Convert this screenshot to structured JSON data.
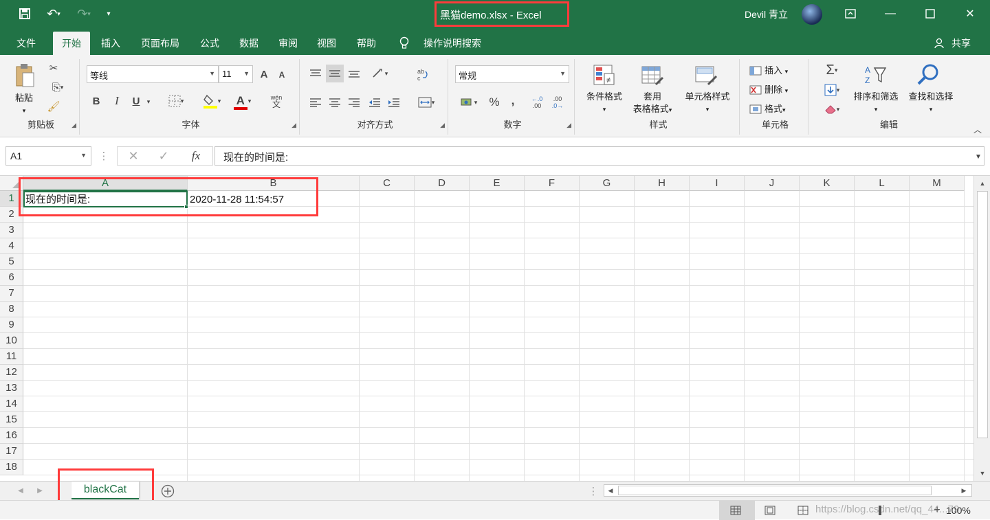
{
  "titlebar": {
    "doc_title": "黑猫demo.xlsx  -  Excel",
    "user_name": "Devil 青立",
    "undo_icon": "undo-icon",
    "redo_icon": "redo-icon"
  },
  "tabs": [
    "文件",
    "开始",
    "插入",
    "页面布局",
    "公式",
    "数据",
    "审阅",
    "视图",
    "帮助"
  ],
  "tell_me": "操作说明搜索",
  "share": "共享",
  "ribbon": {
    "clipboard": {
      "paste": "粘贴",
      "label": "剪贴板"
    },
    "font": {
      "name": "等线",
      "size": "11",
      "bold": "B",
      "italic": "I",
      "underline": "U",
      "label": "字体",
      "increase": "A",
      "decrease": "A",
      "phonetic_top": "wén",
      "phonetic_bottom": "文",
      "font_color": "A"
    },
    "alignment": {
      "label": "对齐方式"
    },
    "number": {
      "format": "常规",
      "percent": "%",
      "comma": ",",
      "label": "数字",
      "inc_decimal": ".00",
      "dec_decimal": ".0"
    },
    "styles": {
      "conditional": "条件格式",
      "table_line1": "套用",
      "table_line2": "表格格式",
      "cell_styles": "单元格样式",
      "label": "样式"
    },
    "cells": {
      "insert": "插入",
      "delete": "删除",
      "format": "格式",
      "label": "单元格"
    },
    "editing": {
      "sort_filter": "排序和筛选",
      "find_select": "查找和选择",
      "label": "编辑"
    }
  },
  "formula_bar": {
    "name_box": "A1",
    "formula": "现在的时间是:",
    "fx": "fx"
  },
  "grid": {
    "columns": [
      "A",
      "B",
      "C",
      "D",
      "E",
      "F",
      "G",
      "H",
      "I",
      "J",
      "K",
      "L",
      "M"
    ],
    "rows": [
      "1",
      "2",
      "3",
      "4",
      "5",
      "6",
      "7",
      "8",
      "9",
      "10",
      "11",
      "12",
      "13",
      "14",
      "15",
      "16",
      "17",
      "18"
    ],
    "cells": {
      "A1": "现在的时间是:",
      "B1": "2020-11-28 11:54:57"
    }
  },
  "sheet": {
    "tab_name": "blackCat"
  },
  "status": {
    "zoom": "100%",
    "watermark": "https://blog.csdn.net/qq_44...79"
  },
  "colors": {
    "brand": "#217346",
    "highlight": "#ff3b3b"
  }
}
